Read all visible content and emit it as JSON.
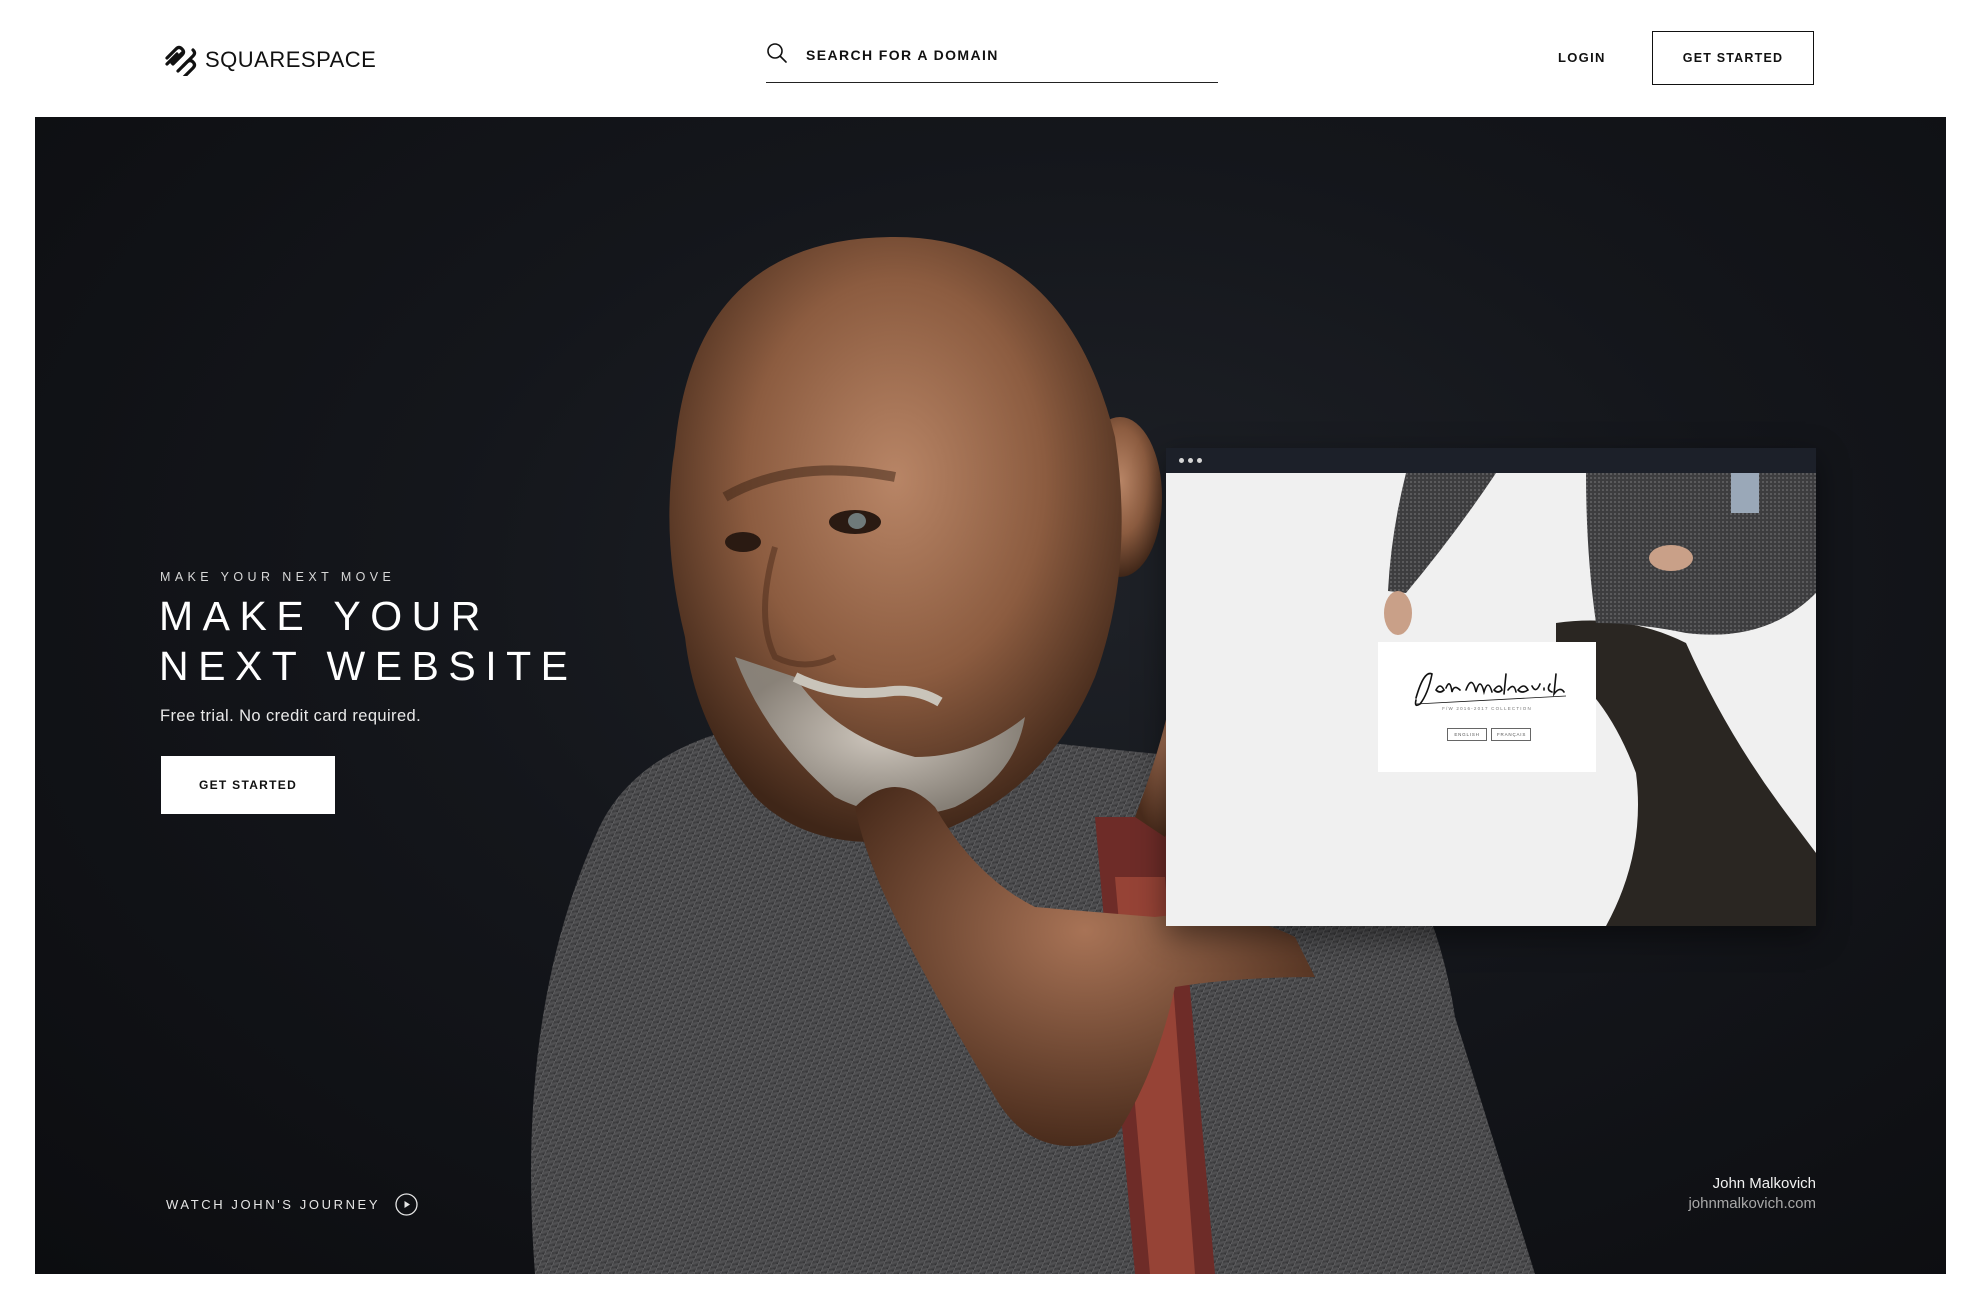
{
  "header": {
    "brand": "SQUARESPACE",
    "logo_icon": "squarespace-logo-icon",
    "search_icon": "search-icon",
    "search_placeholder": "SEARCH FOR A DOMAIN",
    "login_label": "LOGIN",
    "get_started_label": "GET STARTED"
  },
  "hero": {
    "kicker": "MAKE YOUR NEXT MOVE",
    "headline_line1": "MAKE YOUR",
    "headline_line2": "NEXT WEBSITE",
    "subtext": "Free trial. No credit card required.",
    "cta_label": "GET STARTED",
    "watch_label": "WATCH JOHN'S JOURNEY",
    "play_icon": "play-circle-icon",
    "credit_name": "John Malkovich",
    "credit_url": "johnmalkovich.com",
    "background_color": "#14161b"
  },
  "browser_mock": {
    "window_dots_icon": "window-dots-icon",
    "signature_text": "John Malkovich",
    "collection_text": "F/W 2016-2017 COLLECTION",
    "buttons": [
      "ENGLISH",
      "FRANÇAIS"
    ]
  }
}
